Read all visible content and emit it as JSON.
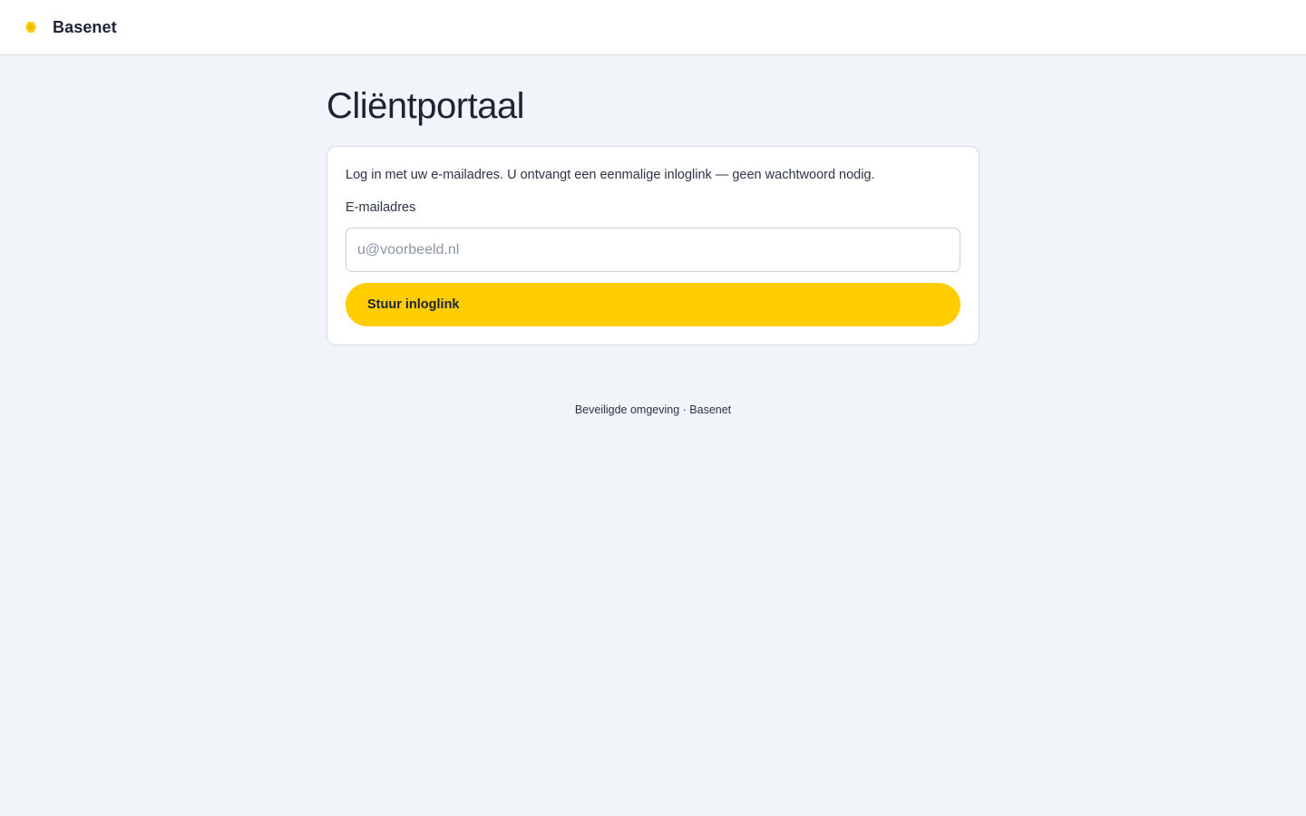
{
  "header": {
    "brand": "Basenet",
    "logo_icon": "basenet-logo-icon",
    "logo_color": "#ffcd00"
  },
  "main": {
    "title": "Cliëntportaal",
    "card": {
      "intro": "Log in met uw e-mailadres. U ontvangt een eenmalige inloglink — geen wachtwoord nodig.",
      "email_label": "E-mailadres",
      "email_value": "",
      "email_placeholder": "u@voorbeeld.nl",
      "submit_label": "Stuur inloglink"
    }
  },
  "footer": {
    "text": "Beveiligde omgeving · Basenet"
  },
  "colors": {
    "accent": "#ffcd00",
    "background": "#f1f5f9",
    "text": "#1e2433"
  }
}
